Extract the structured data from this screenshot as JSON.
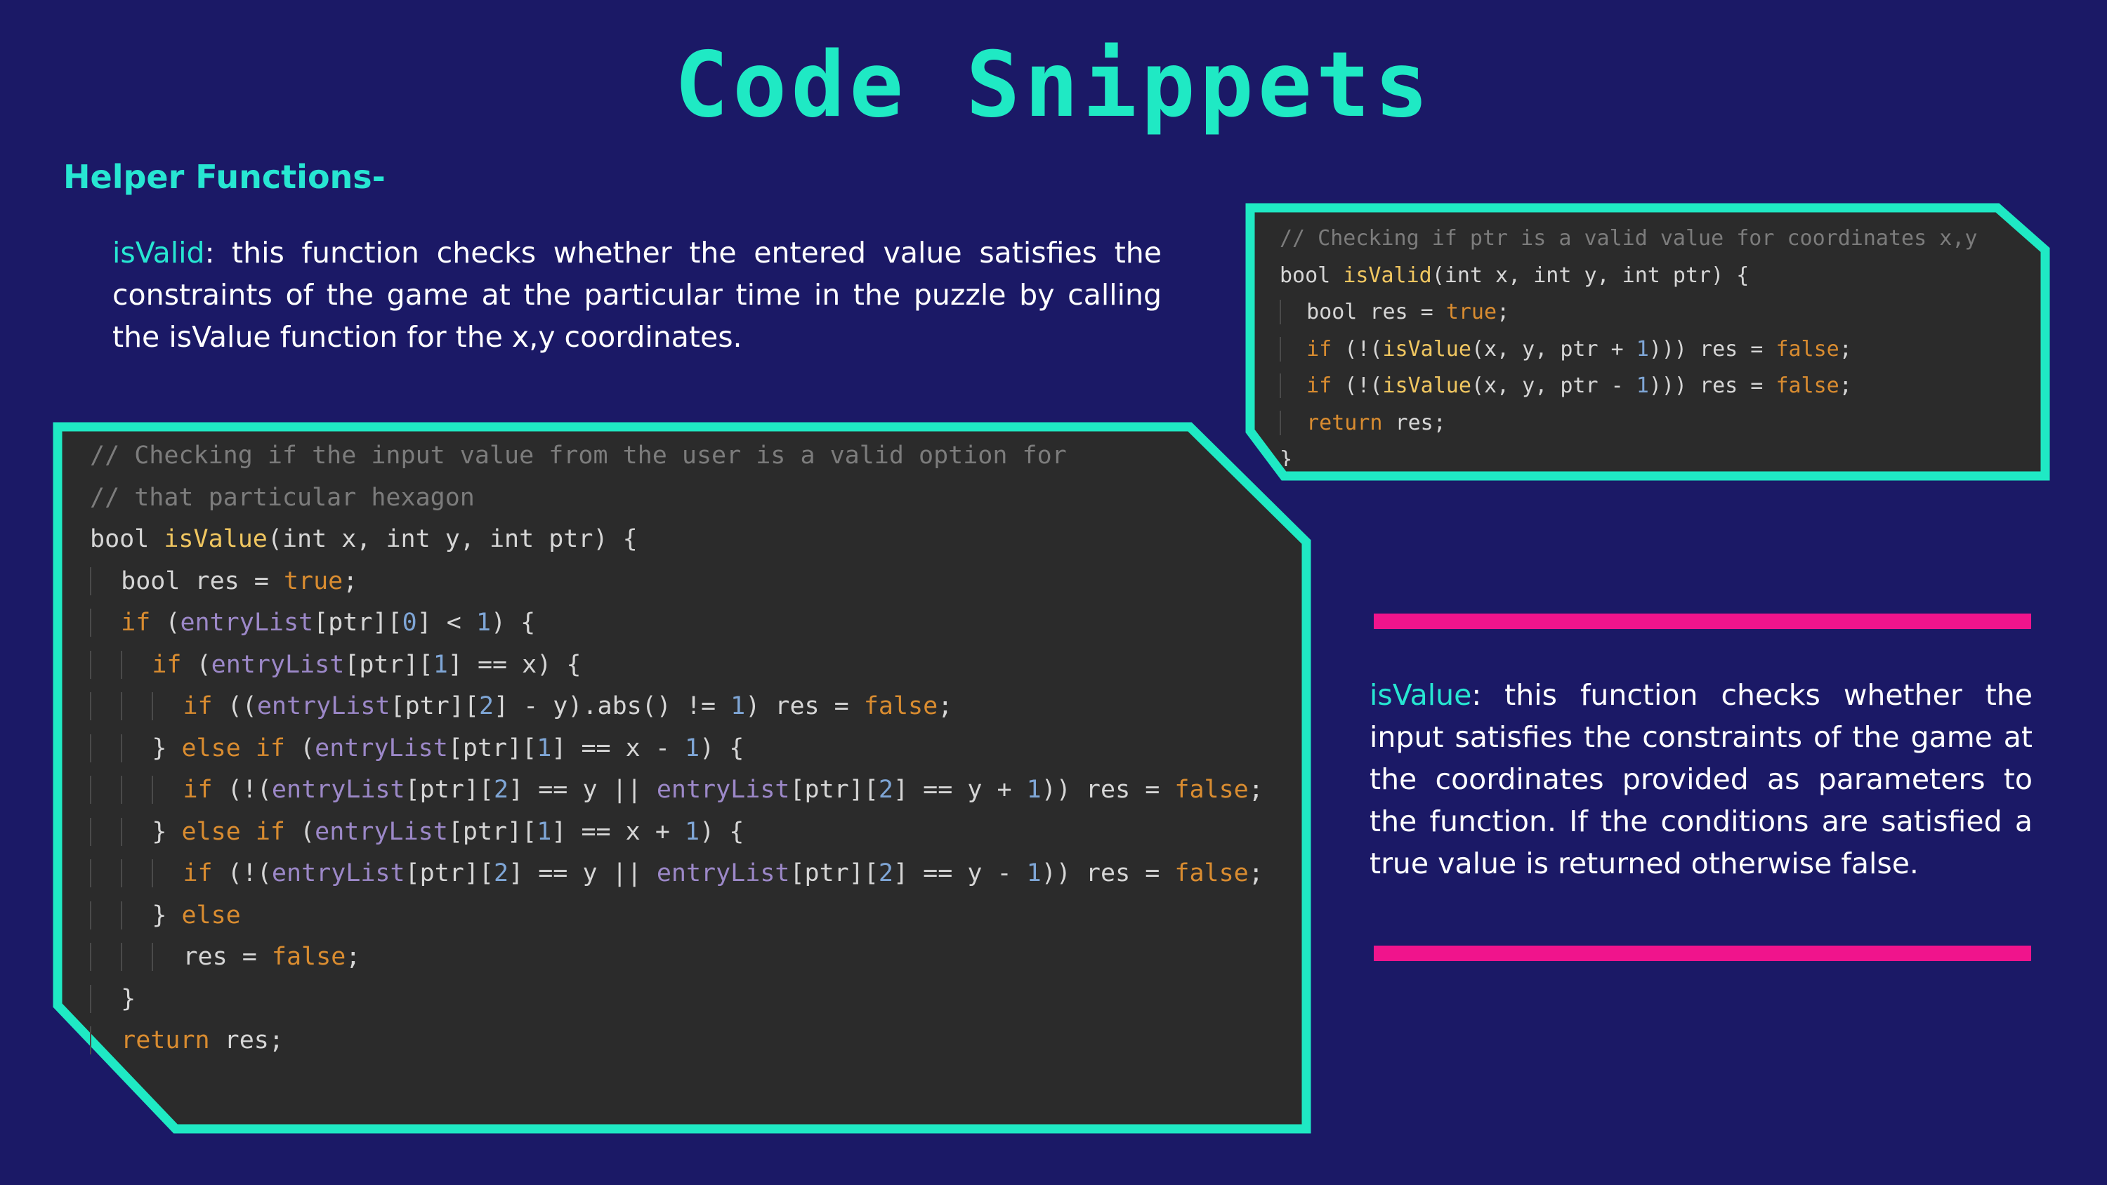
{
  "title": "Code Snippets",
  "section_heading": "Helper Functions-",
  "isvalid_desc": {
    "keyword": "isValid",
    "text": ": this function checks whether the entered value satisfies the constraints of the game at the particular time in the puzzle by calling the isValue function for the x,y coordinates."
  },
  "isvalue_desc": {
    "keyword": "isValue",
    "text": ": this function checks whether the input satisfies the constraints of the game at the coordinates provided as parameters to the function. If the conditions are satisfied a true value is returned otherwise false."
  },
  "code_isvalue": {
    "lines": [
      "// Checking if the input value from the user is a valid option for",
      "// that particular hexagon",
      "bool isValue(int x, int y, int ptr) {",
      "  bool res = true;",
      "  if (entryList[ptr][0] < 1) {",
      "    if (entryList[ptr][1] == x) {",
      "      if ((entryList[ptr][2] - y).abs() != 1) res = false;",
      "    } else if (entryList[ptr][1] == x - 1) {",
      "      if (!(entryList[ptr][2] == y || entryList[ptr][2] == y + 1)) res = false;",
      "    } else if (entryList[ptr][1] == x + 1) {",
      "      if (!(entryList[ptr][2] == y || entryList[ptr][2] == y - 1)) res = false;",
      "    } else",
      "      res = false;",
      "  }",
      "  return res;"
    ]
  },
  "code_isvalid": {
    "lines": [
      "// Checking if ptr is a valid value for coordinates x,y",
      "bool isValid(int x, int y, int ptr) {",
      "  bool res = true;",
      "  if (!(isValue(x, y, ptr + 1))) res = false;",
      "  if (!(isValue(x, y, ptr - 1))) res = false;",
      "  return res;",
      "}"
    ]
  },
  "colors": {
    "background": "#1b1966",
    "accent_teal": "#1fe9c4",
    "accent_pink": "#f0148c",
    "code_bg": "#2b2b2b"
  }
}
